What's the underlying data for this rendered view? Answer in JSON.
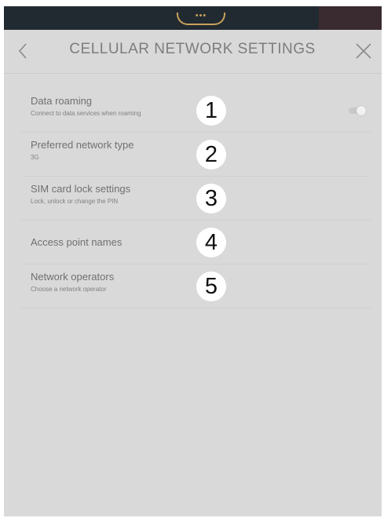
{
  "status_bar": {
    "indicator": "•••"
  },
  "header": {
    "title": "CELLULAR NETWORK SETTINGS",
    "back_icon": "chevron-left-icon",
    "close_icon": "close-icon"
  },
  "settings": [
    {
      "title": "Data roaming",
      "subtitle": "Connect to data services when roaming",
      "badge": "1",
      "toggle": "off"
    },
    {
      "title": "Preferred network type",
      "subtitle": "3G",
      "badge": "2"
    },
    {
      "title": "SIM card lock settings",
      "subtitle": "Lock, unlock or change the PIN",
      "badge": "3"
    },
    {
      "title": "Access point names",
      "badge": "4"
    },
    {
      "title": "Network operators",
      "subtitle": "Choose a network operator",
      "badge": "5"
    }
  ]
}
